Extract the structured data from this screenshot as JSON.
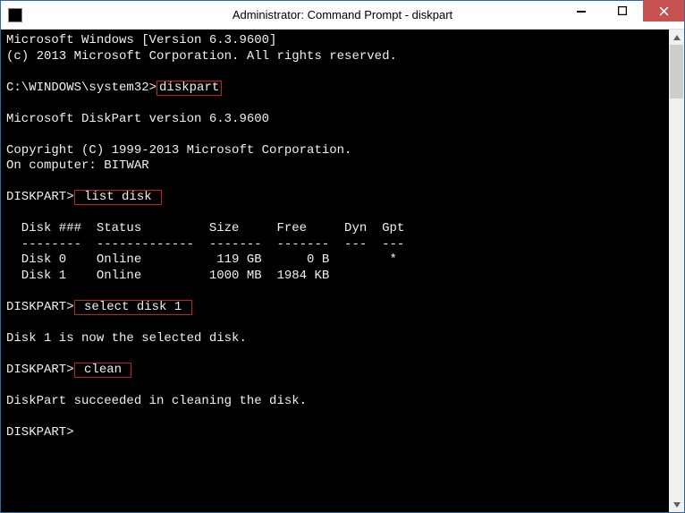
{
  "titlebar": {
    "title": "Administrator: Command Prompt - diskpart"
  },
  "terminal": {
    "line1": "Microsoft Windows [Version 6.3.9600]",
    "line2": "(c) 2013 Microsoft Corporation. All rights reserved.",
    "prompt1_prefix": "C:\\WINDOWS\\system32>",
    "cmd_diskpart": "diskpart",
    "dp_version": "Microsoft DiskPart version 6.3.9600",
    "dp_copyright": "Copyright (C) 1999-2013 Microsoft Corporation.",
    "dp_oncomputer": "On computer: BITWAR",
    "dp_prompt": "DISKPART>",
    "cmd_listdisk": " list disk ",
    "table_header": "  Disk ###  Status         Size     Free     Dyn  Gpt",
    "table_divider": "  --------  -------------  -------  -------  ---  ---",
    "table_row0": "  Disk 0    Online          119 GB      0 B        *",
    "table_row1": "  Disk 1    Online         1000 MB  1984 KB",
    "cmd_select": " select disk 1 ",
    "select_msg": "Disk 1 is now the selected disk.",
    "cmd_clean": " clean ",
    "clean_msg": "DiskPart succeeded in cleaning the disk."
  },
  "chart_data": {
    "type": "table",
    "title": "DISKPART list disk",
    "columns": [
      "Disk ###",
      "Status",
      "Size",
      "Free",
      "Dyn",
      "Gpt"
    ],
    "rows": [
      {
        "Disk ###": "Disk 0",
        "Status": "Online",
        "Size": "119 GB",
        "Free": "0 B",
        "Dyn": "",
        "Gpt": "*"
      },
      {
        "Disk ###": "Disk 1",
        "Status": "Online",
        "Size": "1000 MB",
        "Free": "1984 KB",
        "Dyn": "",
        "Gpt": ""
      }
    ]
  }
}
